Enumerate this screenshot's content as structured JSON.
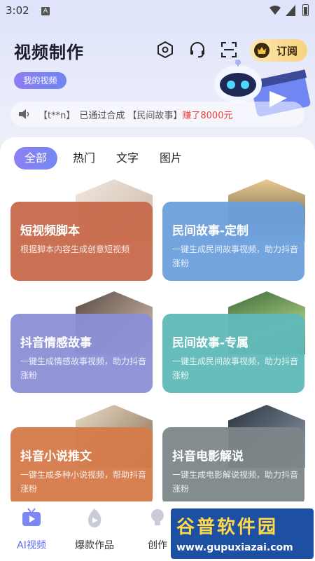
{
  "status_bar": {
    "time": "3:02",
    "badge": "A"
  },
  "header": {
    "title": "视频制作",
    "icons": [
      "hexagon-settings-icon",
      "headset-icon",
      "scan-icon"
    ],
    "subscribe_label": "订阅",
    "my_videos_label": "我的视频"
  },
  "notice": {
    "user": "【t**n】",
    "message": "已通过合成",
    "topic": "【民间故事】",
    "earn": "赚了8000元"
  },
  "tabs": [
    "全部",
    "热门",
    "文字",
    "图片"
  ],
  "active_tab": 0,
  "cards": [
    {
      "title": "短视频脚本",
      "desc": "根据脚本内容生成创意短视频",
      "color": "#c8694a"
    },
    {
      "title": "民间故事-定制",
      "desc": "一键生成民间故事视频，助力抖音涨粉",
      "color": "#6b9fdc"
    },
    {
      "title": "抖音情感故事",
      "desc": "一键生成情感故事视频，助力抖音涨粉",
      "color": "#8b8fd6"
    },
    {
      "title": "民间故事-专属",
      "desc": "一键生成民间故事视频，助力抖音涨粉",
      "color": "#5fb8b8"
    },
    {
      "title": "抖音小说推文",
      "desc": "一键生成多种小说视频，帮助抖音涨粉",
      "color": "#d57a4a"
    },
    {
      "title": "抖音电影解说",
      "desc": "一键生成电影解说视频，助力抖音涨粉",
      "color": "#7c8688"
    }
  ],
  "bottom_nav": [
    {
      "label": "AI视频",
      "icon": "tv-icon",
      "active": true
    },
    {
      "label": "爆款作品",
      "icon": "flame-play-icon",
      "active": false
    },
    {
      "label": "创作",
      "icon": "lightbulb-icon",
      "active": false
    }
  ],
  "watermark": {
    "title": "谷普软件园",
    "url": "www.gupuxiazai.com"
  },
  "colors": {
    "accent": "#6e7ff0",
    "subscribe": "#f8d27e",
    "earn": "#e8413a"
  }
}
